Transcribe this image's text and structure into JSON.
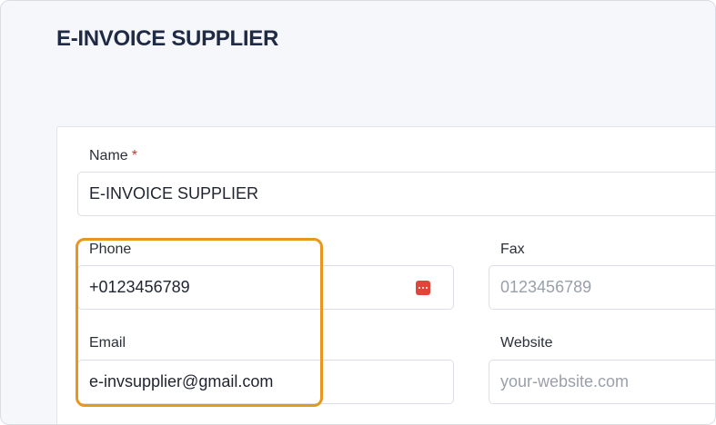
{
  "page": {
    "title": "E-INVOICE SUPPLIER"
  },
  "form": {
    "name": {
      "label": "Name",
      "required_mark": "*",
      "value": "E-INVOICE SUPPLIER"
    },
    "phone": {
      "label": "Phone",
      "value": "+0123456789",
      "icon": "password-manager-icon"
    },
    "fax": {
      "label": "Fax",
      "placeholder": "0123456789"
    },
    "email": {
      "label": "Email",
      "value": "e-invsupplier@gmail.com"
    },
    "website": {
      "label": "Website",
      "placeholder": "your-website.com"
    }
  },
  "colors": {
    "highlight": "#e8961d",
    "required": "#c0392b",
    "title": "#1f2a44"
  }
}
